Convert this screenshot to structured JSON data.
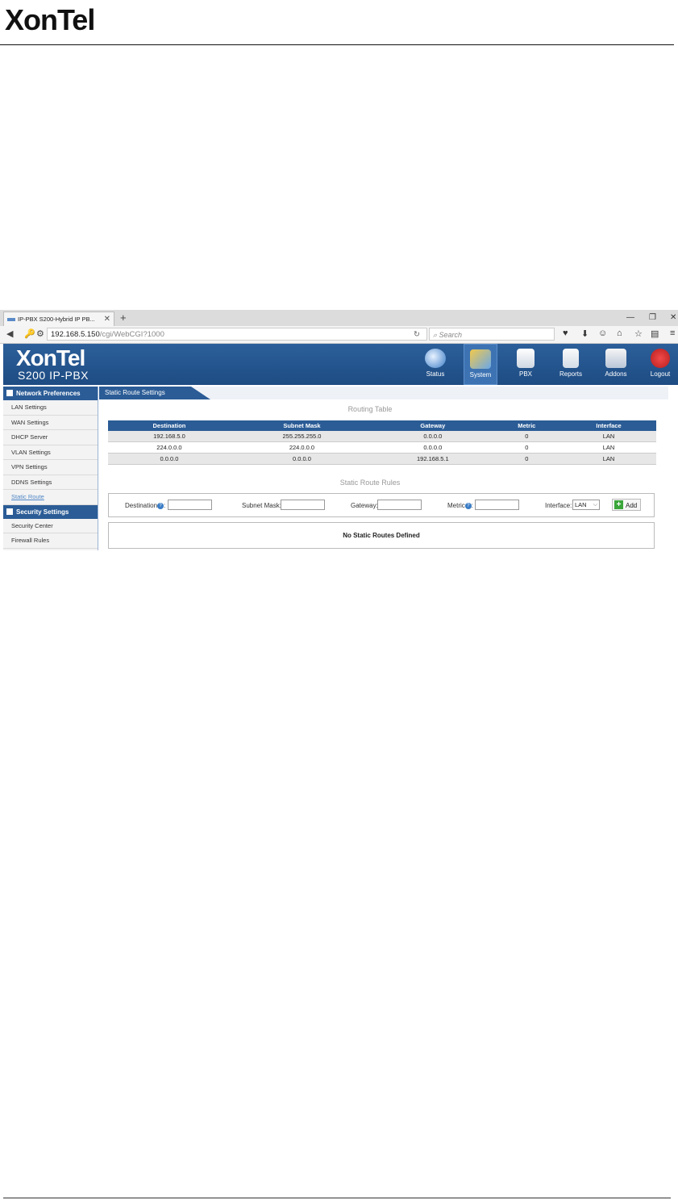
{
  "document": {
    "logo_text": "XonTel"
  },
  "browser": {
    "tab_title": "IP-PBX S200-Hybrid IP PB...",
    "url_host": "192.168.5.150",
    "url_path": "/cgi/WebCGI?1000",
    "search_placeholder": "Search"
  },
  "app": {
    "logo": "XonTel",
    "subtitle": "S200 IP-PBX",
    "nav": [
      {
        "label": "Status",
        "icon": "status-icon"
      },
      {
        "label": "System",
        "icon": "system-icon",
        "active": true
      },
      {
        "label": "PBX",
        "icon": "pbx-icon"
      },
      {
        "label": "Reports",
        "icon": "reports-icon"
      },
      {
        "label": "Addons",
        "icon": "addons-icon"
      },
      {
        "label": "Logout",
        "icon": "logout-icon"
      }
    ]
  },
  "sidebar": {
    "network_heading": "Network Preferences",
    "network_items": [
      "LAN Settings",
      "WAN Settings",
      "DHCP Server",
      "VLAN Settings",
      "VPN Settings",
      "DDNS Settings",
      "Static Route"
    ],
    "security_heading": "Security Settings",
    "security_items": [
      "Security Center",
      "Firewall Rules"
    ]
  },
  "main": {
    "breadcrumb": "Static Route Settings",
    "routing_table_title": "Routing Table",
    "columns": [
      "Destination",
      "Subnet Mask",
      "Gateway",
      "Metric",
      "Interface"
    ],
    "rows": [
      [
        "192.168.5.0",
        "255.255.255.0",
        "0.0.0.0",
        "0",
        "LAN"
      ],
      [
        "224.0.0.0",
        "224.0.0.0",
        "0.0.0.0",
        "0",
        "LAN"
      ],
      [
        "0.0.0.0",
        "0.0.0.0",
        "192.168.5.1",
        "0",
        "LAN"
      ]
    ],
    "rules_title": "Static Route Rules",
    "form": {
      "destination_label": "Destination",
      "subnet_label": "Subnet Mask:",
      "gateway_label": "Gateway:",
      "metric_label": "Metric",
      "interface_label": "Interface:",
      "interface_value": "LAN",
      "add_label": "Add"
    },
    "empty_message": "No Static Routes Defined"
  }
}
